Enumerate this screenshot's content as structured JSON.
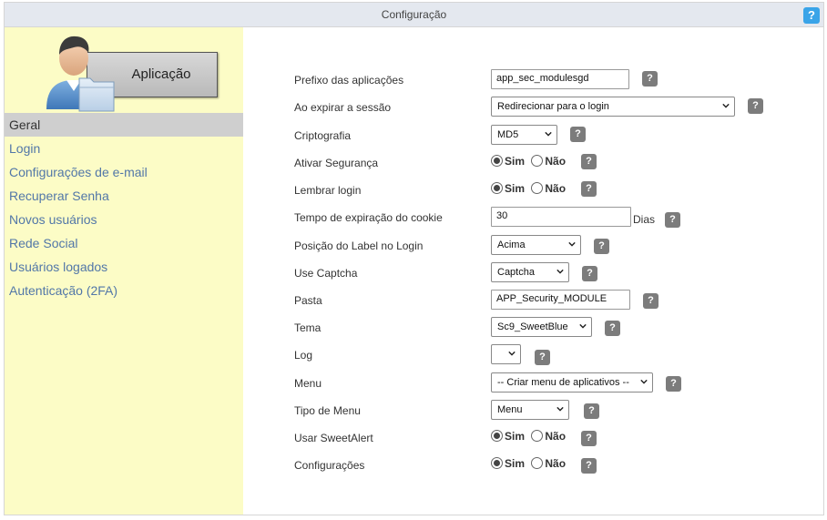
{
  "window": {
    "title": "Configuração",
    "help": "?"
  },
  "app": {
    "label": "Aplicação"
  },
  "sidebar": {
    "items": [
      {
        "label": "Geral",
        "active": true
      },
      {
        "label": "Login"
      },
      {
        "label": "Configurações de e-mail"
      },
      {
        "label": "Recuperar Senha"
      },
      {
        "label": "Novos usuários"
      },
      {
        "label": "Rede Social"
      },
      {
        "label": "Usuários logados"
      },
      {
        "label": "Autenticação (2FA)"
      }
    ]
  },
  "form": {
    "help": "?",
    "radio_yes": "Sim",
    "radio_no": "Não",
    "prefix": {
      "label": "Prefixo das aplicações",
      "value": "app_sec_modulesgd"
    },
    "session": {
      "label": "Ao expirar a sessão",
      "value": "Redirecionar para o login"
    },
    "crypto": {
      "label": "Criptografia",
      "value": "MD5"
    },
    "security": {
      "label": "Ativar Segurança",
      "selected": "Sim"
    },
    "remember": {
      "label": "Lembrar login",
      "selected": "Sim"
    },
    "cookie": {
      "label": "Tempo de expiração do cookie",
      "value": "30",
      "unit": "Dias"
    },
    "label_pos": {
      "label": "Posição do Label no Login",
      "value": "Acima"
    },
    "captcha": {
      "label": "Use Captcha",
      "value": "Captcha"
    },
    "folder": {
      "label": "Pasta",
      "value": "APP_Security_MODULE"
    },
    "theme": {
      "label": "Tema",
      "value": "Sc9_SweetBlue"
    },
    "log": {
      "label": "Log",
      "value": ""
    },
    "menu": {
      "label": "Menu",
      "value": "-- Criar menu de aplicativos --"
    },
    "menu_type": {
      "label": "Tipo de Menu",
      "value": "Menu"
    },
    "sweetalert": {
      "label": "Usar SweetAlert",
      "selected": "Sim"
    },
    "settings": {
      "label": "Configurações",
      "selected": "Sim"
    }
  },
  "colors": {
    "sidebar_bg": "#fcfcc6",
    "link": "#5277a8",
    "help_blue": "#3aa4e8",
    "help_grey": "#7c7c7c"
  }
}
